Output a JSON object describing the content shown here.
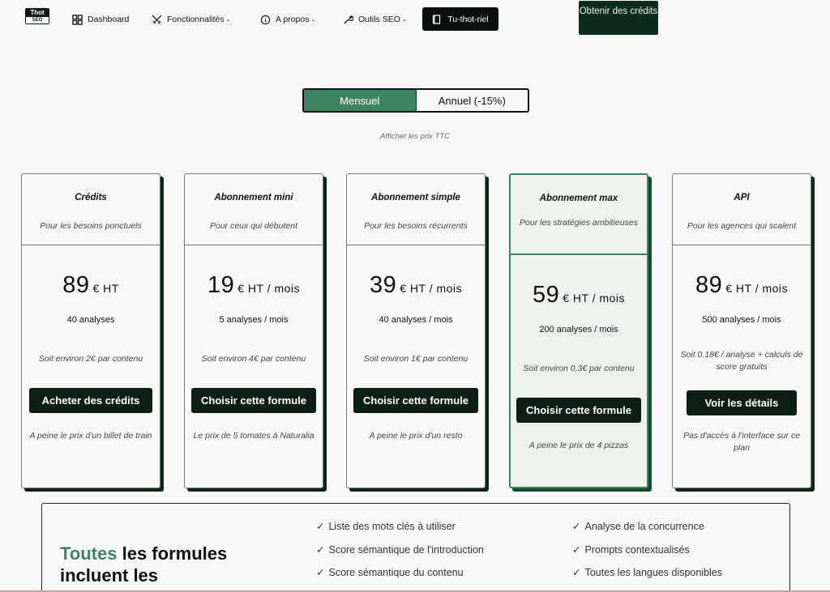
{
  "nav": {
    "logo_line1": "Thot",
    "logo_line2": "SEO",
    "dashboard": "Dashboard",
    "fonctionnalites": "Fonctionnalités",
    "apropos": "A propos",
    "outils": "Outils SEO",
    "tuto": "Tu-thot-riel",
    "credits_button": "Obtenir des crédits"
  },
  "billing": {
    "monthly": "Mensuel",
    "yearly": "Annuel (-15%)",
    "ttc_link": "Afficher les prix TTC"
  },
  "plans": [
    {
      "title": "Crédits",
      "subtitle": "Pour les besoins ponctuels",
      "price": "89",
      "unit": "€ HT",
      "quantity": "40 analyses",
      "per_content": "Soit environ 2€ par contenu",
      "cta": "Acheter des crédits",
      "note": "A peine le prix d'un billet de train"
    },
    {
      "title": "Abonnement mini",
      "subtitle": "Pour ceux qui débutent",
      "price": "19",
      "unit": "€ HT / mois",
      "quantity": "5 analyses / mois",
      "per_content": "Soit environ 4€ par contenu",
      "cta": "Choisir cette formule",
      "note": "Le prix de 5 tomates à Naturalia"
    },
    {
      "title": "Abonnement simple",
      "subtitle": "Pour les besoins récurrents",
      "price": "39",
      "unit": "€ HT / mois",
      "quantity": "40 analyses / mois",
      "per_content": "Soit environ 1€ par contenu",
      "cta": "Choisir cette formule",
      "note": "A peine le prix d'un resto"
    },
    {
      "title": "Abonnement max",
      "subtitle": "Pour les stratégies ambitieuses",
      "price": "59",
      "unit": "€ HT / mois",
      "quantity": "200 analyses / mois",
      "per_content": "Soit environ 0,3€ par contenu",
      "cta": "Choisir cette formule",
      "note": "A peine le prix de 4 pizzas"
    },
    {
      "title": "API",
      "subtitle": "Pour les agences qui scalent",
      "price": "89",
      "unit": "€ HT / mois",
      "quantity": "500 analyses / mois",
      "per_content": "Soit 0.18€ / analyse + calculs de score gratuits",
      "cta": "Voir les détails",
      "note": "Pas d'accès à l'interface sur ce plan"
    }
  ],
  "included": {
    "title_accent": "Toutes",
    "title_rest": "les formules incluent les",
    "col1": [
      "Liste des mots clés à utiliser",
      "Score sémantique de l'introduction",
      "Score sémantique du contenu"
    ],
    "col2": [
      "Analyse de la concurrence",
      "Prompts contextualisés",
      "Toutes les langues disponibles"
    ],
    "check": "✓"
  }
}
